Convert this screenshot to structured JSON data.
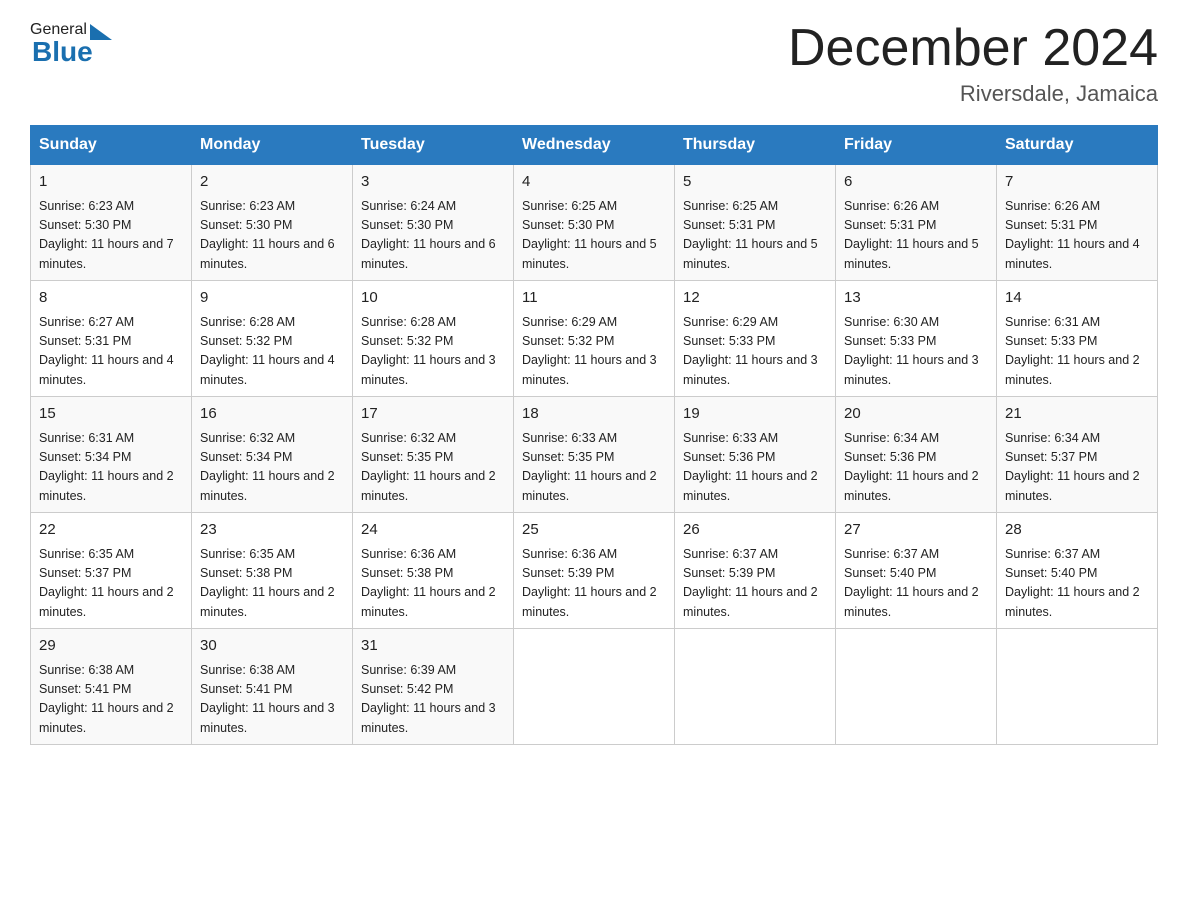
{
  "header": {
    "logo_general": "General",
    "logo_blue": "Blue",
    "month_title": "December 2024",
    "location": "Riversdale, Jamaica"
  },
  "columns": [
    "Sunday",
    "Monday",
    "Tuesday",
    "Wednesday",
    "Thursday",
    "Friday",
    "Saturday"
  ],
  "weeks": [
    [
      {
        "day": "1",
        "sunrise": "6:23 AM",
        "sunset": "5:30 PM",
        "daylight": "11 hours and 7 minutes."
      },
      {
        "day": "2",
        "sunrise": "6:23 AM",
        "sunset": "5:30 PM",
        "daylight": "11 hours and 6 minutes."
      },
      {
        "day": "3",
        "sunrise": "6:24 AM",
        "sunset": "5:30 PM",
        "daylight": "11 hours and 6 minutes."
      },
      {
        "day": "4",
        "sunrise": "6:25 AM",
        "sunset": "5:30 PM",
        "daylight": "11 hours and 5 minutes."
      },
      {
        "day": "5",
        "sunrise": "6:25 AM",
        "sunset": "5:31 PM",
        "daylight": "11 hours and 5 minutes."
      },
      {
        "day": "6",
        "sunrise": "6:26 AM",
        "sunset": "5:31 PM",
        "daylight": "11 hours and 5 minutes."
      },
      {
        "day": "7",
        "sunrise": "6:26 AM",
        "sunset": "5:31 PM",
        "daylight": "11 hours and 4 minutes."
      }
    ],
    [
      {
        "day": "8",
        "sunrise": "6:27 AM",
        "sunset": "5:31 PM",
        "daylight": "11 hours and 4 minutes."
      },
      {
        "day": "9",
        "sunrise": "6:28 AM",
        "sunset": "5:32 PM",
        "daylight": "11 hours and 4 minutes."
      },
      {
        "day": "10",
        "sunrise": "6:28 AM",
        "sunset": "5:32 PM",
        "daylight": "11 hours and 3 minutes."
      },
      {
        "day": "11",
        "sunrise": "6:29 AM",
        "sunset": "5:32 PM",
        "daylight": "11 hours and 3 minutes."
      },
      {
        "day": "12",
        "sunrise": "6:29 AM",
        "sunset": "5:33 PM",
        "daylight": "11 hours and 3 minutes."
      },
      {
        "day": "13",
        "sunrise": "6:30 AM",
        "sunset": "5:33 PM",
        "daylight": "11 hours and 3 minutes."
      },
      {
        "day": "14",
        "sunrise": "6:31 AM",
        "sunset": "5:33 PM",
        "daylight": "11 hours and 2 minutes."
      }
    ],
    [
      {
        "day": "15",
        "sunrise": "6:31 AM",
        "sunset": "5:34 PM",
        "daylight": "11 hours and 2 minutes."
      },
      {
        "day": "16",
        "sunrise": "6:32 AM",
        "sunset": "5:34 PM",
        "daylight": "11 hours and 2 minutes."
      },
      {
        "day": "17",
        "sunrise": "6:32 AM",
        "sunset": "5:35 PM",
        "daylight": "11 hours and 2 minutes."
      },
      {
        "day": "18",
        "sunrise": "6:33 AM",
        "sunset": "5:35 PM",
        "daylight": "11 hours and 2 minutes."
      },
      {
        "day": "19",
        "sunrise": "6:33 AM",
        "sunset": "5:36 PM",
        "daylight": "11 hours and 2 minutes."
      },
      {
        "day": "20",
        "sunrise": "6:34 AM",
        "sunset": "5:36 PM",
        "daylight": "11 hours and 2 minutes."
      },
      {
        "day": "21",
        "sunrise": "6:34 AM",
        "sunset": "5:37 PM",
        "daylight": "11 hours and 2 minutes."
      }
    ],
    [
      {
        "day": "22",
        "sunrise": "6:35 AM",
        "sunset": "5:37 PM",
        "daylight": "11 hours and 2 minutes."
      },
      {
        "day": "23",
        "sunrise": "6:35 AM",
        "sunset": "5:38 PM",
        "daylight": "11 hours and 2 minutes."
      },
      {
        "day": "24",
        "sunrise": "6:36 AM",
        "sunset": "5:38 PM",
        "daylight": "11 hours and 2 minutes."
      },
      {
        "day": "25",
        "sunrise": "6:36 AM",
        "sunset": "5:39 PM",
        "daylight": "11 hours and 2 minutes."
      },
      {
        "day": "26",
        "sunrise": "6:37 AM",
        "sunset": "5:39 PM",
        "daylight": "11 hours and 2 minutes."
      },
      {
        "day": "27",
        "sunrise": "6:37 AM",
        "sunset": "5:40 PM",
        "daylight": "11 hours and 2 minutes."
      },
      {
        "day": "28",
        "sunrise": "6:37 AM",
        "sunset": "5:40 PM",
        "daylight": "11 hours and 2 minutes."
      }
    ],
    [
      {
        "day": "29",
        "sunrise": "6:38 AM",
        "sunset": "5:41 PM",
        "daylight": "11 hours and 2 minutes."
      },
      {
        "day": "30",
        "sunrise": "6:38 AM",
        "sunset": "5:41 PM",
        "daylight": "11 hours and 3 minutes."
      },
      {
        "day": "31",
        "sunrise": "6:39 AM",
        "sunset": "5:42 PM",
        "daylight": "11 hours and 3 minutes."
      },
      null,
      null,
      null,
      null
    ]
  ]
}
